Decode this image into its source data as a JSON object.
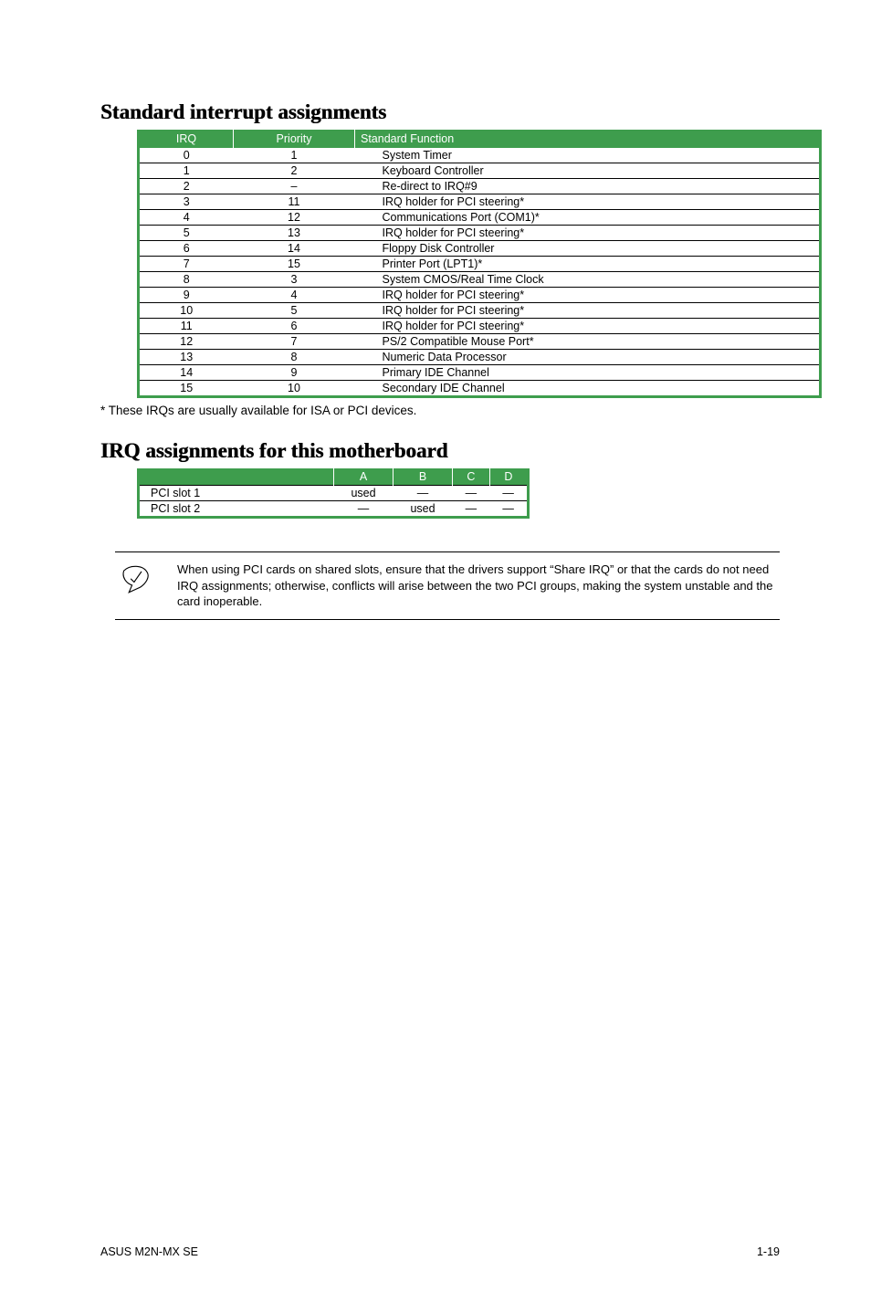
{
  "sections": {
    "standard_title": "Standard interrupt assignments",
    "assignments_title": "IRQ assignments for this motherboard"
  },
  "irq_table": {
    "headers": {
      "irq": "IRQ",
      "priority": "Priority",
      "function": "Standard Function"
    },
    "rows": [
      {
        "irq": "0",
        "priority": "1",
        "function": "System Timer"
      },
      {
        "irq": "1",
        "priority": "2",
        "function": "Keyboard Controller"
      },
      {
        "irq": "2",
        "priority": "–",
        "function": "Re-direct to IRQ#9"
      },
      {
        "irq": "3",
        "priority": "11",
        "function": "IRQ holder for PCI steering*"
      },
      {
        "irq": "4",
        "priority": "12",
        "function": "Communications Port (COM1)*"
      },
      {
        "irq": "5",
        "priority": "13",
        "function": "IRQ holder for PCI steering*"
      },
      {
        "irq": "6",
        "priority": "14",
        "function": "Floppy Disk Controller"
      },
      {
        "irq": "7",
        "priority": "15",
        "function": "Printer Port (LPT1)*"
      },
      {
        "irq": "8",
        "priority": "3",
        "function": "System CMOS/Real Time Clock"
      },
      {
        "irq": "9",
        "priority": "4",
        "function": "IRQ holder for PCI steering*"
      },
      {
        "irq": "10",
        "priority": "5",
        "function": "IRQ holder for PCI steering*"
      },
      {
        "irq": "11",
        "priority": "6",
        "function": "IRQ holder for PCI steering*"
      },
      {
        "irq": "12",
        "priority": "7",
        "function": "PS/2 Compatible Mouse Port*"
      },
      {
        "irq": "13",
        "priority": "8",
        "function": "Numeric Data Processor"
      },
      {
        "irq": "14",
        "priority": "9",
        "function": "Primary IDE Channel"
      },
      {
        "irq": "15",
        "priority": "10",
        "function": "Secondary IDE Channel"
      }
    ]
  },
  "footnote": "* These IRQs are usually available for ISA or PCI devices.",
  "assign_table": {
    "headers": {
      "blank": "",
      "a": "A",
      "b": "B",
      "c": "C",
      "d": "D"
    },
    "rows": [
      {
        "label": "PCI slot 1",
        "a": "used",
        "b": "—",
        "c": "—",
        "d": "—"
      },
      {
        "label": "PCI slot 2",
        "a": "—",
        "b": "used",
        "c": "—",
        "d": "—"
      }
    ]
  },
  "note_text": "When using PCI cards on shared slots, ensure that the drivers support “Share IRQ” or that the cards do not need IRQ assignments; otherwise, conflicts will arise between the two PCI groups, making the system unstable and the card inoperable.",
  "footer": {
    "left": "ASUS M2N-MX SE",
    "right": "1-19"
  }
}
